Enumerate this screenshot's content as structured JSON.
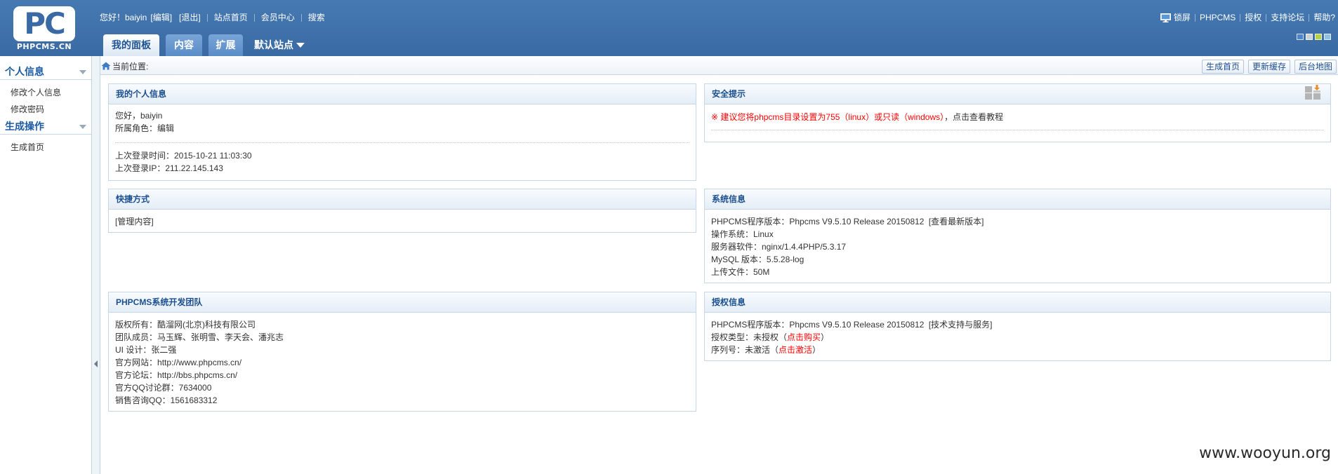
{
  "header": {
    "logo": {
      "mark": "PC",
      "wordmark": "PHPCMS.CN"
    },
    "user": {
      "greeting": "您好！baiyin",
      "edit": "[编辑]",
      "logout": "[退出]"
    },
    "top_links": {
      "site_home": "站点首页",
      "member_center": "会员中心",
      "search": "搜索"
    },
    "tabs": [
      {
        "label": "我的面板",
        "active": true
      },
      {
        "label": "内容",
        "active": false
      },
      {
        "label": "扩展",
        "active": false
      }
    ],
    "site_select": "默认站点",
    "right_links": {
      "lock_screen": "锁屏",
      "phpcms": "PHPCMS",
      "license": "授权",
      "forum": "支持论坛",
      "help": "帮助?"
    },
    "theme_swatches": [
      "#4f86c9",
      "#c9d1d9",
      "#b6d04a",
      "#8cc2e8"
    ]
  },
  "breadcrumb": {
    "label": "当前位置:"
  },
  "toolbar": {
    "generate_home": "生成首页",
    "update_cache": "更新缓存",
    "site_map": "后台地图"
  },
  "sidebar": {
    "groups": [
      {
        "title": "个人信息",
        "items": [
          "修改个人信息",
          "修改密码"
        ]
      },
      {
        "title": "生成操作",
        "items": [
          "生成首页"
        ]
      }
    ]
  },
  "panels": {
    "my_info": {
      "title": "我的个人信息",
      "greeting": "您好，baiyin",
      "role": "所属角色：编辑",
      "last_login_time": "上次登录时间：2015-10-21 11:03:30",
      "last_login_ip": "上次登录IP：211.22.145.143"
    },
    "security": {
      "title": "安全提示",
      "warning": "※ 建议您将phpcms目录设置为755（linux）或只读（windows）",
      "tutorial_link": "，点击查看教程"
    },
    "shortcuts": {
      "title": "快捷方式",
      "items": [
        "[管理内容]"
      ]
    },
    "system_info": {
      "title": "系统信息",
      "version": "PHPCMS程序版本：Phpcms V9.5.10 Release 20150812",
      "version_link": "[查看最新版本]",
      "os": "操作系统：Linux",
      "server": "服务器软件：nginx/1.4.4PHP/5.3.17",
      "mysql": "MySQL 版本：5.5.28-log",
      "upload": "上传文件：50M"
    },
    "team": {
      "title": "PHPCMS系统开发团队",
      "copyright": "版权所有：酷溜网(北京)科技有限公司",
      "members": "团队成员：马玉辉、张明雪、李天会、潘兆志",
      "ui": "UI 设计：张二强",
      "website_label": "官方网站：",
      "website": "http://www.phpcms.cn/",
      "forum_label": "官方论坛：",
      "forum": "http://bbs.phpcms.cn/",
      "qq_group": "官方QQ讨论群：7634000",
      "sales_qq": "销售咨询QQ：1561683312"
    },
    "license": {
      "title": "授权信息",
      "version": "PHPCMS程序版本：Phpcms V9.5.10 Release 20150812",
      "support_link": "[技术支持与服务]",
      "type_label": "授权类型：未授权（",
      "buy_link": "点击购买",
      "type_close": "）",
      "serial_label": "序列号：未激活（",
      "activate_link": "点击激活",
      "serial_close": "）"
    }
  },
  "watermark": "www.wooyun.org",
  "icons": {
    "lock_screen": "monitor-icon",
    "breadcrumb": "home-icon",
    "sidebar_group": "chevron-down-icon",
    "collapse": "arrow-left-icon",
    "security_panel": "grid-arrow-icon",
    "site_select": "caret-down-icon"
  },
  "colors": {
    "header": "#3a6aa3",
    "panel_title": "#1b4f8f",
    "sidebar_heading": "#1c5aa3",
    "warning": "#ff0000"
  }
}
